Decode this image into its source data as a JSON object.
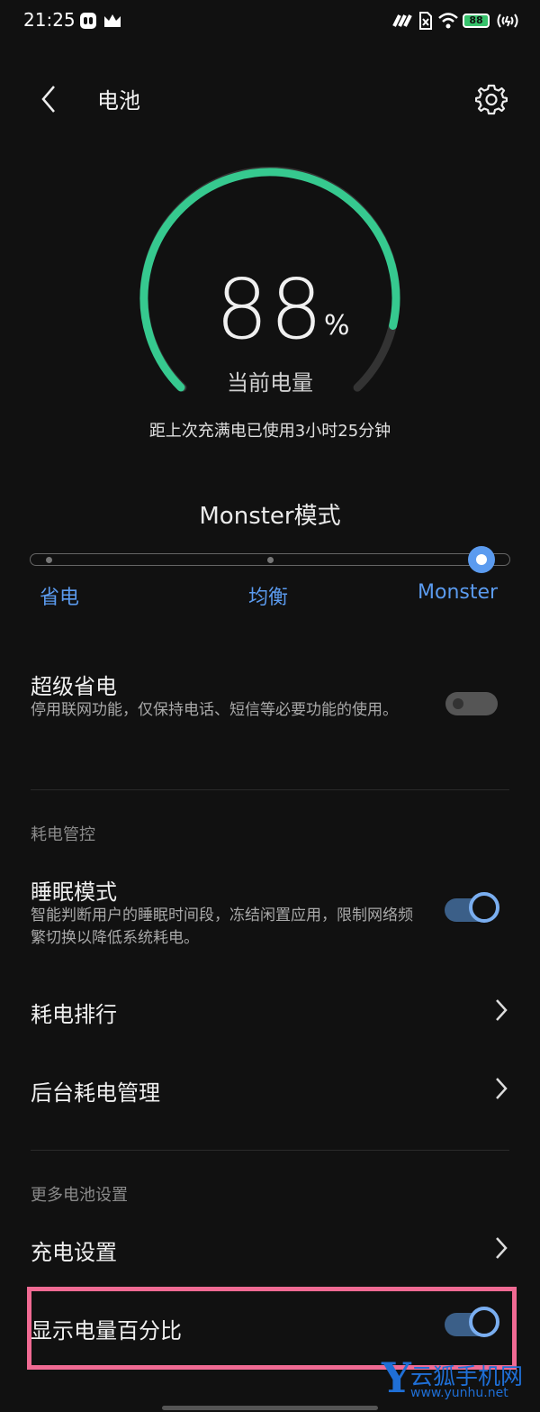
{
  "status_bar": {
    "time": "21:25",
    "battery_level": "88",
    "icons": [
      "monster-app-icon",
      "crown-icon",
      "signal-icon",
      "sim-icon",
      "wifi-icon",
      "battery-icon",
      "hotspot-icon"
    ]
  },
  "header": {
    "title": "电池",
    "back_icon": "chevron-left-icon",
    "settings_icon": "gear-icon"
  },
  "battery": {
    "percent": "88",
    "percent_sign": "%",
    "label": "当前电量",
    "level_fraction": 0.88,
    "usage_text": "距上次充满电已使用3小时25分钟",
    "gauge_color": "#36c98f"
  },
  "mode": {
    "title": "Monster模式",
    "options": [
      "省电",
      "均衡",
      "Monster"
    ],
    "selected": "Monster",
    "accent": "#5b9bef"
  },
  "super_saver": {
    "title": "超级省电",
    "description": "停用联网功能，仅保持电话、短信等必要功能的使用。",
    "enabled": false
  },
  "power_control": {
    "section_title": "耗电管控",
    "sleep_mode": {
      "title": "睡眠模式",
      "description": "智能判断用户的睡眠时间段，冻结闲置应用，限制网络频繁切换以降低系统耗电。",
      "enabled": true
    },
    "ranking": {
      "title": "耗电排行"
    },
    "background": {
      "title": "后台耗电管理"
    }
  },
  "more_settings": {
    "section_title": "更多电池设置",
    "charging": {
      "title": "充电设置"
    },
    "show_percentage": {
      "title": "显示电量百分比",
      "enabled": true
    }
  },
  "watermark": {
    "logo": "Y",
    "name": "云狐手机网",
    "url": "www.yunhu.net"
  },
  "highlight_color": "#f06a93"
}
